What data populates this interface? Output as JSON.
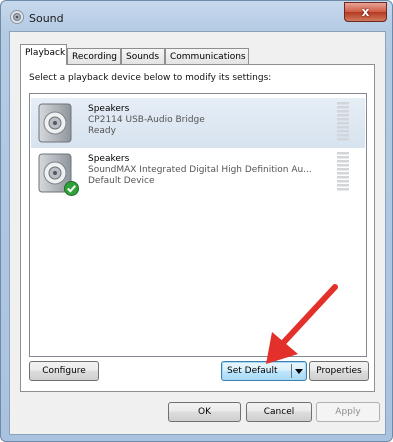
{
  "window": {
    "title": "Sound",
    "close_label": "x"
  },
  "tabs": [
    {
      "label": "Playback",
      "active": true
    },
    {
      "label": "Recording",
      "active": false
    },
    {
      "label": "Sounds",
      "active": false
    },
    {
      "label": "Communications",
      "active": false
    }
  ],
  "instruction": "Select a playback device below to modify its settings:",
  "devices": [
    {
      "name": "Speakers",
      "description": "CP2114 USB-Audio Bridge",
      "status": "Ready",
      "icon": "speaker-icon",
      "selected": true,
      "default": false
    },
    {
      "name": "Speakers",
      "description": "SoundMAX Integrated Digital High Definition Au...",
      "status": "Default Device",
      "icon": "speaker-icon",
      "selected": false,
      "default": true
    }
  ],
  "buttons": {
    "configure": "Configure",
    "set_default": "Set Default",
    "properties": "Properties",
    "ok": "OK",
    "cancel": "Cancel",
    "apply": "Apply"
  },
  "colors": {
    "annotation_arrow": "#e3302b",
    "default_check": "#2fa33a",
    "selection": "#dce7f2"
  }
}
